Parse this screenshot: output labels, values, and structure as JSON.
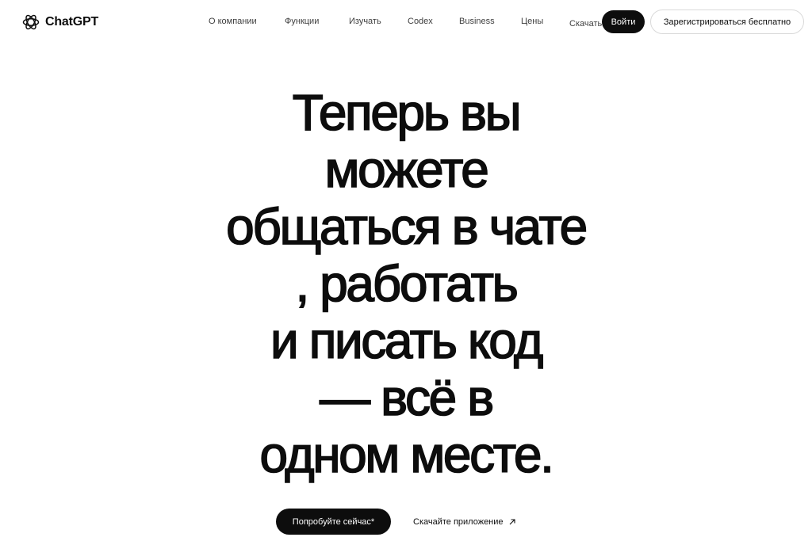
{
  "header": {
    "logo_text": "ChatGPT",
    "nav": [
      {
        "label": "О компании"
      },
      {
        "label": "Функции"
      },
      {
        "label": "Изучать"
      },
      {
        "label": "Codex"
      },
      {
        "label": "Business"
      },
      {
        "label": "Цены"
      },
      {
        "label": "Скачать"
      }
    ],
    "login_label": "Войти",
    "signup_label": "Зарегистрироваться бесплатно"
  },
  "hero": {
    "title_lines": [
      "Теперь вы",
      "можете",
      "общаться в чате",
      ", работать",
      "и писать код",
      "— всё в",
      "одном месте."
    ],
    "primary_cta": "Попробуйте сейчас*",
    "secondary_cta": "Скачайте приложение"
  },
  "icons": {
    "logo": "openai-logo-icon",
    "secondary_cta": "arrow-up-right-icon"
  },
  "colors": {
    "text": "#0d0d0d",
    "background": "#ffffff",
    "button_dark": "#0d0d0d",
    "button_border": "#d9d9d9"
  }
}
